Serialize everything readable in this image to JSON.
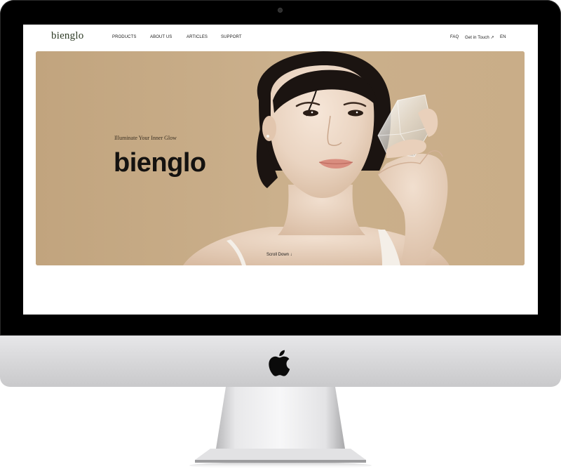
{
  "nav": {
    "brand": "bienglo",
    "links": [
      "PRODUCTS",
      "ABOUT US",
      "ARTICLES",
      "SUPPORT"
    ],
    "faq": "FAQ",
    "get_in_touch": "Get in Touch ↗",
    "language": "EN"
  },
  "hero": {
    "tagline": "Illuminate Your Inner Glow",
    "title": "bienglo",
    "scroll_down": "Scroll Down ↓"
  },
  "colors": {
    "hero_background": "#c8ad88",
    "brand_green": "#2e3b26",
    "frame": "#000000"
  },
  "icons": {
    "camera": "camera-dot-icon",
    "apple": "apple-logo-icon"
  }
}
